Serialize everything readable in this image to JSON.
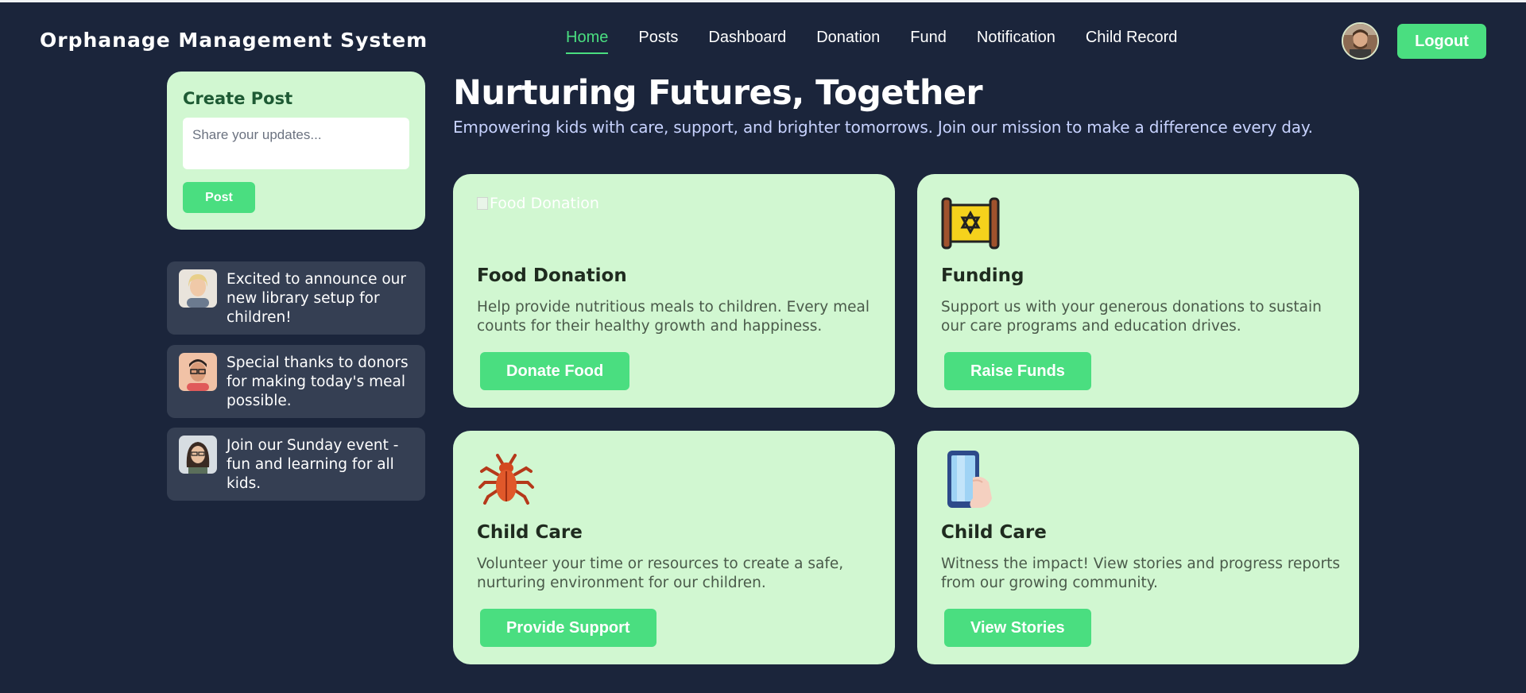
{
  "header": {
    "brand": "Orphanage Management System",
    "nav": [
      "Home",
      "Posts",
      "Dashboard",
      "Donation",
      "Fund",
      "Notification",
      "Child Record"
    ],
    "active_nav": "Home",
    "logout_label": "Logout"
  },
  "create_post": {
    "title": "Create Post",
    "placeholder": "Share your updates...",
    "button_label": "Post"
  },
  "feed": [
    {
      "text": "Excited to announce our new library setup for children!",
      "avatar": "woman-blonde-avatar"
    },
    {
      "text": "Special thanks to donors for making today's meal possible.",
      "avatar": "man-glasses-avatar"
    },
    {
      "text": "Join our Sunday event - fun and learning for all kids.",
      "avatar": "woman-dark-hair-avatar"
    }
  ],
  "hero": {
    "title": "Nurturing Futures, Together",
    "subtitle": "Empowering kids with care, support, and brighter tomorrows. Join our mission to make a difference every day."
  },
  "cards": [
    {
      "image_alt": "Food Donation",
      "icon": "broken-image-icon",
      "title": "Food Donation",
      "description": "Help provide nutritious meals to children. Every meal counts for their healthy growth and happiness.",
      "button": "Donate Food"
    },
    {
      "icon": "scroll-star-icon",
      "title": "Funding",
      "description": "Support us with your generous donations to sustain our care programs and education drives.",
      "button": "Raise Funds"
    },
    {
      "icon": "bug-icon",
      "title": "Child Care",
      "description": "Volunteer your time or resources to create a safe, nurturing environment for our children.",
      "button": "Provide Support"
    },
    {
      "icon": "phone-hand-icon",
      "title": "Child Care",
      "description": "Witness the impact! View stories and progress reports from our growing community.",
      "button": "View Stories"
    }
  ],
  "colors": {
    "background": "#1b253b",
    "accent": "#4ade80",
    "card": "#d1f7d1",
    "feed_card": "#353f53"
  }
}
